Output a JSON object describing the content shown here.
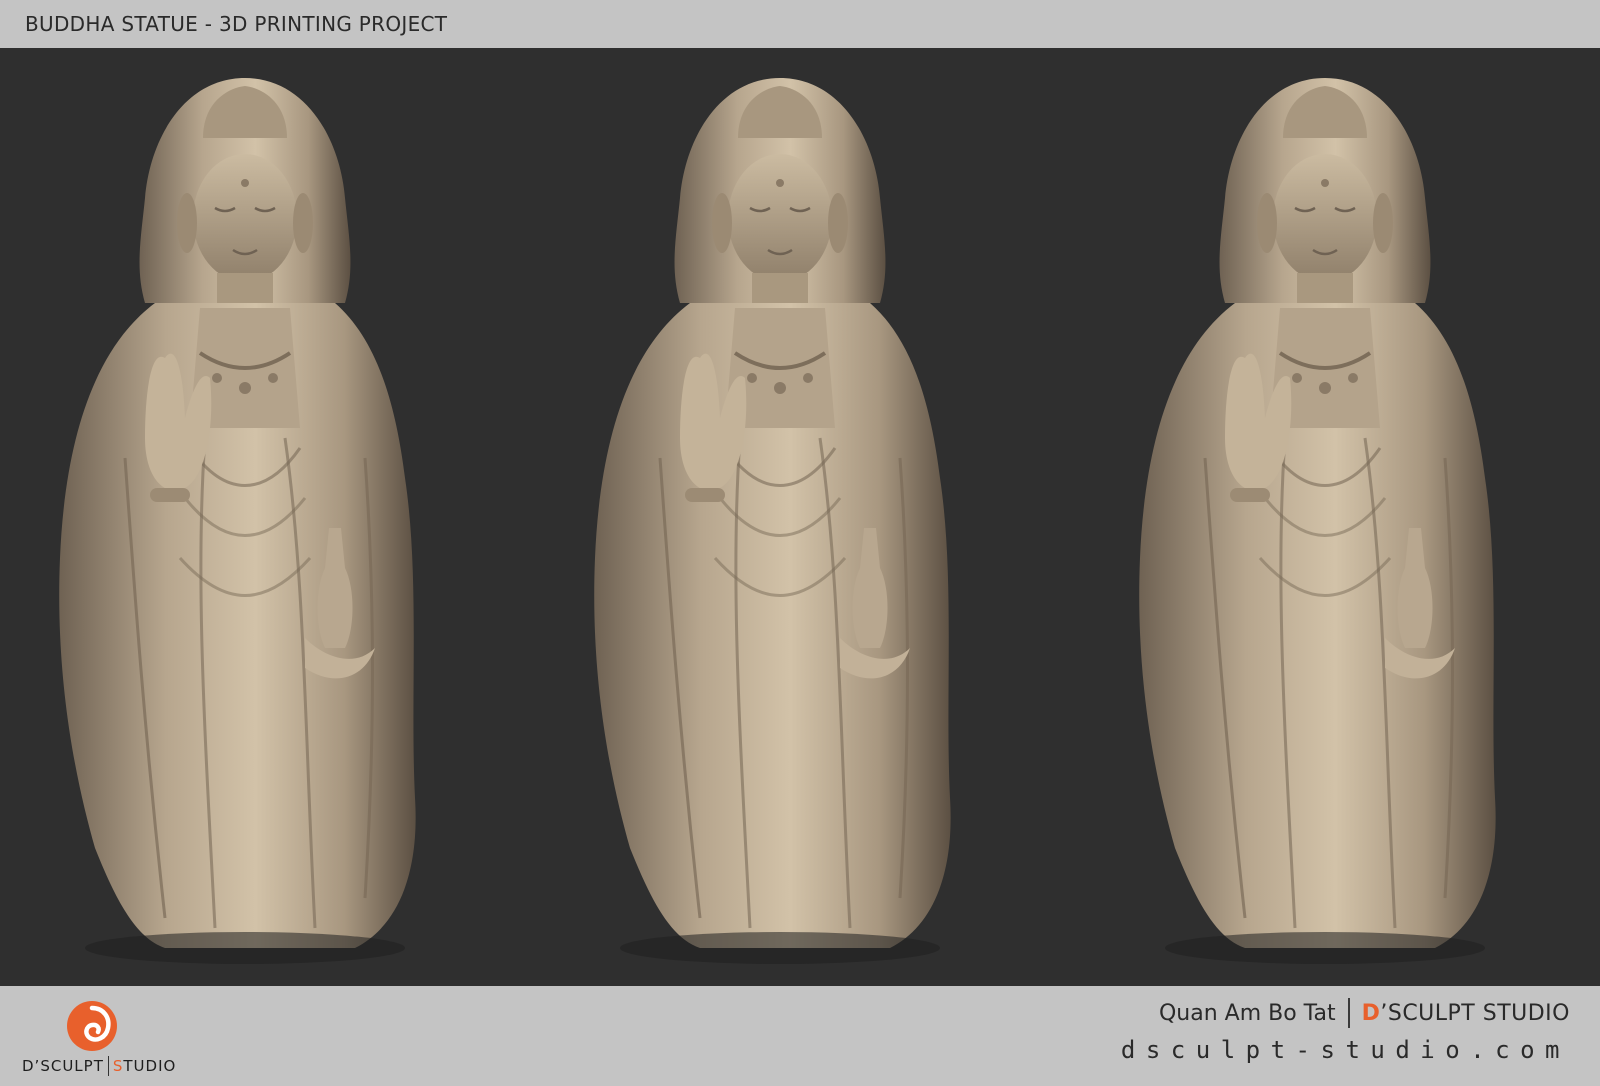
{
  "header": {
    "title": "BUDDHA STATUE - 3D PRINTING PROJECT"
  },
  "footer": {
    "logo": {
      "brand": "D’SCULPT",
      "studio_initial": "S",
      "studio_rest": "TUDIO"
    },
    "credit": {
      "name": "Quan Am Bo Tat",
      "studio_initial": "D",
      "studio_rest": "’SCULPT STUDIO"
    },
    "website": "dsculpt-studio.com"
  },
  "colors": {
    "background": "#2f2f2f",
    "bars": "#c4c4c4",
    "statue": "#b9a88f",
    "accent": "#e8602c"
  }
}
